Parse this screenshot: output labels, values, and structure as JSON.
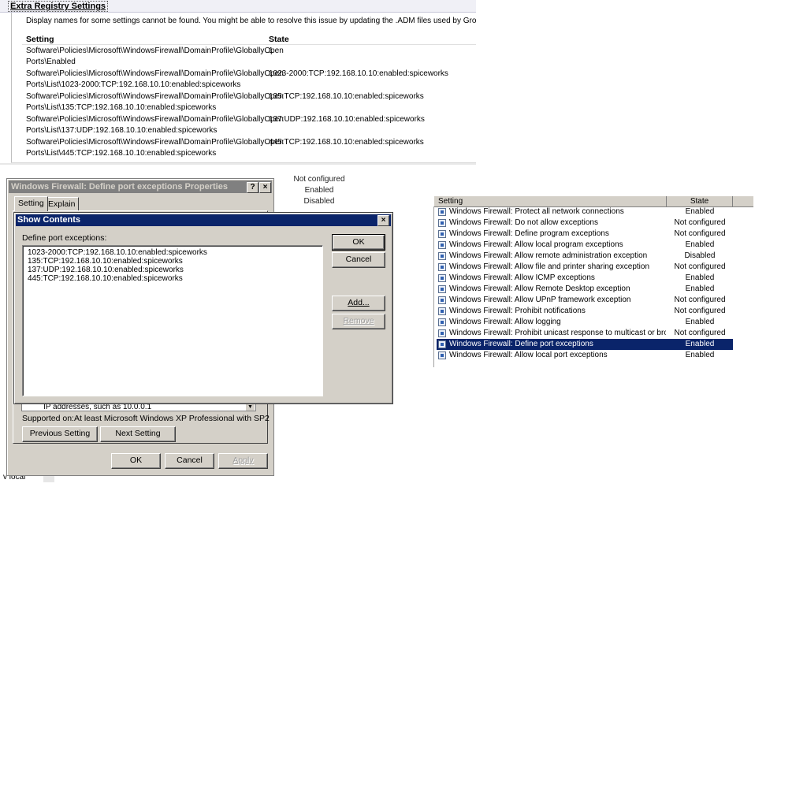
{
  "registry": {
    "title": "Extra Registry Settings",
    "notice": "Display names for some settings cannot be found. You might be able to resolve this issue by updating the .ADM files used by Group Policy Managr",
    "col_setting": "Setting",
    "col_state": "State",
    "rows": [
      {
        "setting": "Software\\Policies\\Microsoft\\WindowsFirewall\\DomainProfile\\GloballyOpen\nPorts\\Enabled",
        "state": "1"
      },
      {
        "setting": "Software\\Policies\\Microsoft\\WindowsFirewall\\DomainProfile\\GloballyOpen\nPorts\\List\\1023-2000:TCP:192.168.10.10:enabled:spiceworks",
        "state": "1023-2000:TCP:192.168.10.10:enabled:spiceworks"
      },
      {
        "setting": "Software\\Policies\\Microsoft\\WindowsFirewall\\DomainProfile\\GloballyOpen\nPorts\\List\\135:TCP:192.168.10.10:enabled:spiceworks",
        "state": "135:TCP:192.168.10.10:enabled:spiceworks"
      },
      {
        "setting": "Software\\Policies\\Microsoft\\WindowsFirewall\\DomainProfile\\GloballyOpen\nPorts\\List\\137:UDP:192.168.10.10:enabled:spiceworks",
        "state": "137:UDP:192.168.10.10:enabled:spiceworks"
      },
      {
        "setting": "Software\\Policies\\Microsoft\\WindowsFirewall\\DomainProfile\\GloballyOpen\nPorts\\List\\445:TCP:192.168.10.10:enabled:spiceworks",
        "state": "445:TCP:192.168.10.10:enabled:spiceworks"
      }
    ]
  },
  "background": {
    "states": [
      "Not configured",
      "Enabled",
      "Disabled"
    ],
    "fragment_text": "v local"
  },
  "properties_dialog": {
    "title": "Windows Firewall: Define port exceptions Properties",
    "help_button": "?",
    "close_button": "×",
    "tabs": {
      "setting": "Setting",
      "explain": "Explain"
    },
    "ip_text": "IP addresses, such as 10.0.0.1",
    "supported_label": "Supported on:",
    "supported_value": "At least Microsoft Windows XP Professional with SP2",
    "previous_setting": "Previous Setting",
    "next_setting": "Next Setting",
    "ok": "OK",
    "cancel": "Cancel",
    "apply": "Apply"
  },
  "show_contents": {
    "title": "Show Contents",
    "close_button": "×",
    "label": "Define port exceptions:",
    "items": [
      "1023-2000:TCP:192.168.10.10:enabled:spiceworks",
      "135:TCP:192.168.10.10:enabled:spiceworks",
      "137:UDP:192.168.10.10:enabled:spiceworks",
      "445:TCP:192.168.10.10:enabled:spiceworks"
    ],
    "ok": "OK",
    "cancel": "Cancel",
    "add": "Add...",
    "remove": "Remove"
  },
  "policy_list": {
    "col_setting": "Setting",
    "col_state": "State",
    "selected_index": 11,
    "rows": [
      {
        "name": "Windows Firewall: Protect all network connections",
        "state": "Enabled"
      },
      {
        "name": "Windows Firewall: Do not allow exceptions",
        "state": "Not configured"
      },
      {
        "name": "Windows Firewall: Define program exceptions",
        "state": "Not configured"
      },
      {
        "name": "Windows Firewall: Allow local program exceptions",
        "state": "Enabled"
      },
      {
        "name": "Windows Firewall: Allow remote administration exception",
        "state": "Disabled"
      },
      {
        "name": "Windows Firewall: Allow file and printer sharing exception",
        "state": "Not configured"
      },
      {
        "name": "Windows Firewall: Allow ICMP exceptions",
        "state": "Enabled"
      },
      {
        "name": "Windows Firewall: Allow Remote Desktop exception",
        "state": "Enabled"
      },
      {
        "name": "Windows Firewall: Allow UPnP framework exception",
        "state": "Not configured"
      },
      {
        "name": "Windows Firewall: Prohibit notifications",
        "state": "Not configured"
      },
      {
        "name": "Windows Firewall: Allow logging",
        "state": "Enabled"
      },
      {
        "name": "Windows Firewall: Prohibit unicast response to multicast or broad…",
        "state": "Not configured"
      },
      {
        "name": "Windows Firewall: Define port exceptions",
        "state": "Enabled"
      },
      {
        "name": "Windows Firewall: Allow local port exceptions",
        "state": "Enabled"
      }
    ]
  }
}
